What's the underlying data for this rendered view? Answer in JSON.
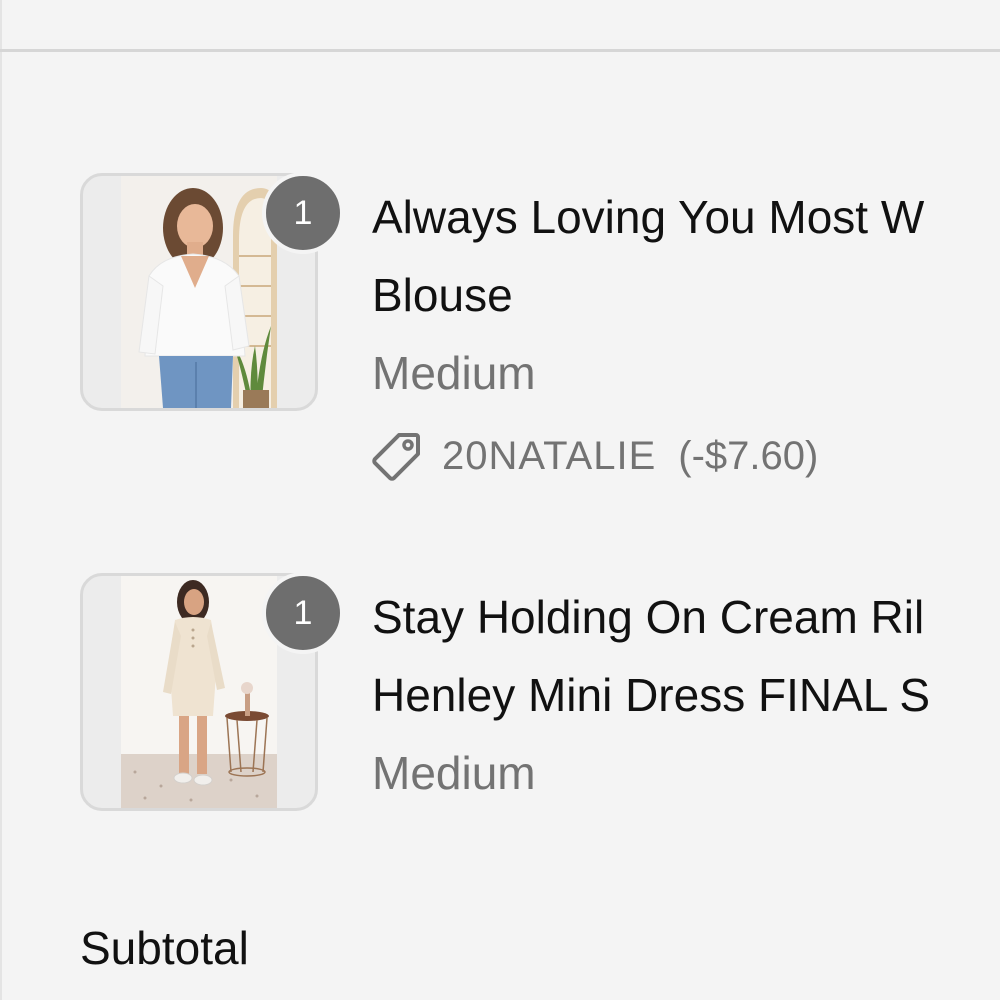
{
  "cart": {
    "items": [
      {
        "quantity": "1",
        "title_line1": "Always Loving You Most W",
        "title_line2": "Blouse",
        "variant": "Medium",
        "image_icon": "product-photo-white-blouse",
        "discount": {
          "icon": "tag-icon",
          "code": "20NATALIE",
          "amount": "(-$7.60)"
        }
      },
      {
        "quantity": "1",
        "title_line1": "Stay Holding On Cream Ril",
        "title_line2": "Henley Mini Dress FINAL S",
        "variant": "Medium",
        "image_icon": "product-photo-cream-dress"
      }
    ]
  },
  "summary": {
    "subtotal_label": "Subtotal"
  },
  "colors": {
    "background": "#f4f4f4",
    "badge": "#6e6e6e",
    "secondary_text": "#737373",
    "primary_text": "#111111"
  }
}
